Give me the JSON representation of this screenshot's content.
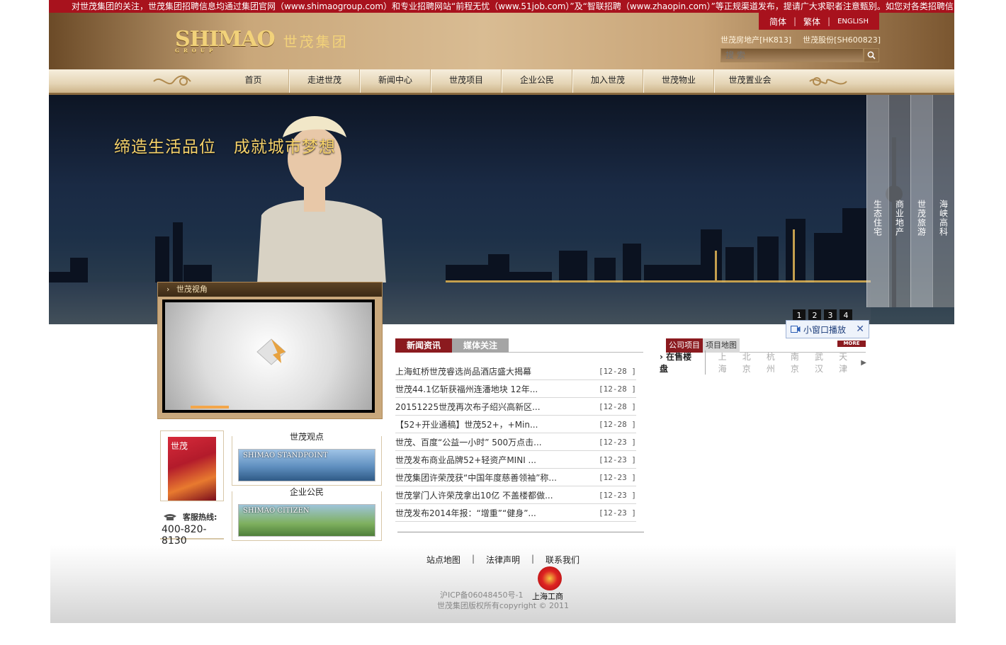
{
  "ticker": "对世茂集团的关注，世茂集团招聘信息均通过集团官网（www.shimaogroup.com）和专业招聘网站“前程无忧（www.51job.com）”及“智联招聘（www.zhaopin.com）”等正规渠道发布，提请广大求职者注意甄别。如您对各类招聘信",
  "header": {
    "lang": [
      "简体",
      "繁体",
      "ENGLISH"
    ],
    "logo_mark": "SHIMAO",
    "logo_sub": "GROUP",
    "logo_cn": "世茂集团",
    "stocks": [
      "世茂房地产[HK813]",
      "世茂股份[SH600823]"
    ],
    "search_placeholder": "搜 索"
  },
  "nav": [
    "首页",
    "走进世茂",
    "新闻中心",
    "世茂项目",
    "企业公民",
    "加入世茂",
    "世茂物业",
    "世茂置业会"
  ],
  "banner": {
    "slogan": "缔造生活品位   成就城市梦想",
    "vertical_tabs": [
      "生态住宅",
      "商业地产",
      "世茂旅游",
      "海峡高科"
    ],
    "dots": [
      "1",
      "2",
      "3",
      "4"
    ]
  },
  "video": {
    "title": "世茂视角"
  },
  "mini_play": {
    "label": "小窗口播放",
    "close": "✕"
  },
  "left": {
    "magazine_title": "世茂",
    "hotline_label": "客服热线:",
    "hotline_number": "400-820-8130",
    "promo1_title": "世茂观点",
    "promo1_img": "SHIMAO STANDPOINT",
    "promo2_title": "企业公民",
    "promo2_img": "SHIMAO CITIZEN"
  },
  "news": {
    "tabs": [
      "新闻资讯",
      "媒体关注"
    ],
    "items": [
      {
        "title": "上海虹桥世茂睿选尚品酒店盛大揭幕",
        "date": "[12-28 ]"
      },
      {
        "title": "世茂44.1亿斩获福州连潘地块 12年...",
        "date": "[12-28 ]"
      },
      {
        "title": "20151225世茂再次布子绍兴高新区...",
        "date": "[12-28 ]"
      },
      {
        "title": "【52+开业通稿】世茂52+，+Min...",
        "date": "[12-28 ]"
      },
      {
        "title": "世茂、百度“公益一小时” 500万点击...",
        "date": "[12-23 ]"
      },
      {
        "title": "世茂发布商业品牌52+轻资产MINI ...",
        "date": "[12-23 ]"
      },
      {
        "title": "世茂集团许荣茂获“中国年度慈善领袖”称...",
        "date": "[12-23 ]"
      },
      {
        "title": "世茂掌门人许荣茂拿出10亿 不盖楼都做...",
        "date": "[12-23 ]"
      },
      {
        "title": "世茂发布2014年报：“增重”“健身”...",
        "date": "[12-23 ]"
      }
    ]
  },
  "projects": {
    "tabs": [
      "公司项目",
      "项目地图"
    ],
    "more": "MORE",
    "label": "在售楼盘",
    "cities": [
      "上海",
      "北京",
      "杭州",
      "南京",
      "武汉",
      "天津"
    ]
  },
  "footer": {
    "links": [
      "站点地图",
      "法律声明",
      "联系我们"
    ],
    "icp": "沪ICP备06048450号-1",
    "gs": "上海工商",
    "copyright": "世茂集团版权所有copyright © 2011"
  },
  "colors": {
    "brand_red": "#a8121d",
    "tab_red": "#8b1a1f",
    "gold": "#f7d36a"
  }
}
